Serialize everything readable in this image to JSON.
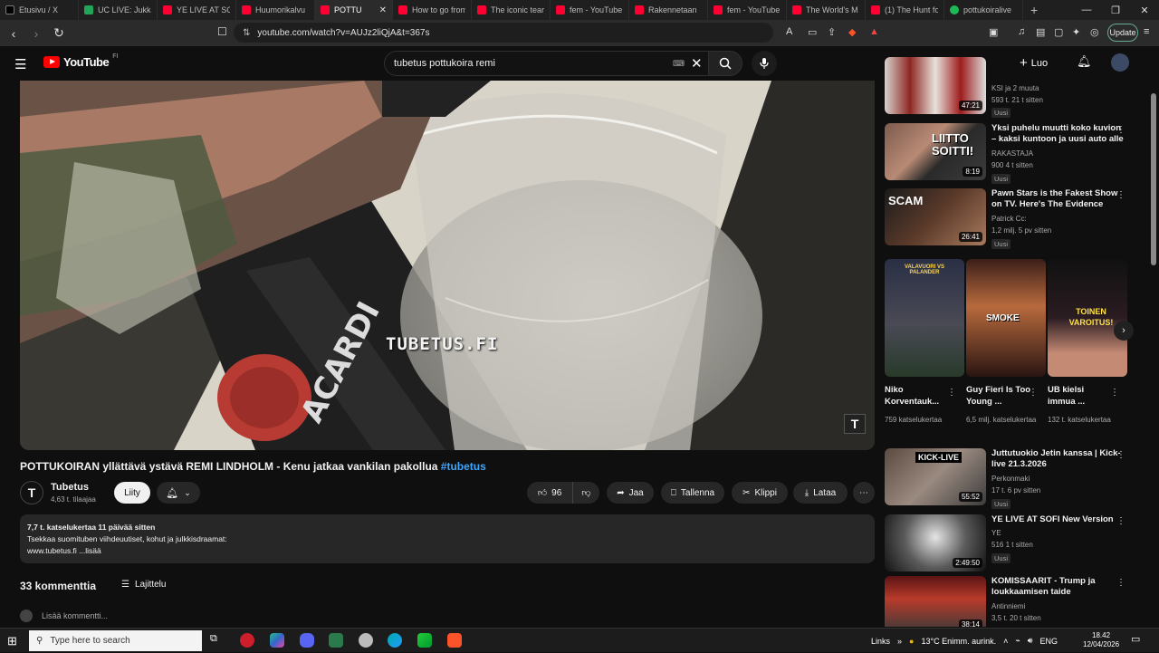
{
  "browser": {
    "tabs": [
      {
        "title": "Etusivu / X",
        "icon": "x"
      },
      {
        "title": "UC LIVE: Jukka",
        "icon": "sp"
      },
      {
        "title": "YE LIVE AT SOFI",
        "icon": "yt"
      },
      {
        "title": "Huumorikalvu",
        "icon": "yt"
      },
      {
        "title": "POTTU",
        "icon": "yt",
        "active": true
      },
      {
        "title": "How to go from",
        "icon": "yt"
      },
      {
        "title": "The iconic tear",
        "icon": "yt"
      },
      {
        "title": "fem - YouTube",
        "icon": "yt"
      },
      {
        "title": "Rakennetaan",
        "icon": "yt"
      },
      {
        "title": "fem - YouTube",
        "icon": "yt"
      },
      {
        "title": "The World's M",
        "icon": "yt"
      },
      {
        "title": "(1) The Hunt fo",
        "icon": "yt"
      },
      {
        "title": "pottukoiralive",
        "icon": "g"
      }
    ],
    "url": "youtube.com/watch?v=AUJz2liQjA&t=367s",
    "update_label": "Update"
  },
  "youtube": {
    "logo_text": "YouTube",
    "country": "FI",
    "search_value": "tubetus pottukoira remi",
    "create_label": "Luo"
  },
  "video": {
    "watermark": "TUBETUS.FI",
    "channel_bug": "T",
    "title": "POTTUKOIRAN yllättävä ystävä REMI LINDHOLM - Kenu jatkaa vankilan pakollua",
    "hashtag": "#tubetus",
    "channel_name": "Tubetus",
    "subscribers": "4,63 t. tilaajaa",
    "join_label": "Liity",
    "like_count": "96",
    "share_label": "Jaa",
    "save_label": "Tallenna",
    "clip_label": "Klippi",
    "download_label": "Lataa"
  },
  "description": {
    "meta": "7,7 t. katselukertaa  11 päivää sitten",
    "line1": "Tsekkaa suomituben viihdeuutiset, kohut ja julkkisdraamat:",
    "line2": "www.tubetus.fi ...lisää"
  },
  "comments": {
    "count": "33 kommenttia",
    "sort_label": "Lajittelu",
    "placeholder": "Lisää kommentti..."
  },
  "recommendations": [
    {
      "title": "",
      "channel": "KSI ja 2 muuta",
      "stats": "593 t.  21 t sitten",
      "badge": "Uusi",
      "duration": "47:21"
    },
    {
      "title": "Yksi puhelu muutti koko kuvion – kaksi kuntoon ja uusi auto alle",
      "channel": "RAKASTAJA",
      "stats": "900  4 t sitten",
      "badge": "Uusi",
      "duration": "8:19",
      "thumb_text": "LIITTO SOITTI!"
    },
    {
      "title": "Pawn Stars is the Fakest Show on TV. Here's The Evidence",
      "channel": "Patrick Cc:",
      "stats": "1,2 milj.  5 pv sitten",
      "badge": "Uusi",
      "duration": "26:41",
      "thumb_text": "SCAM"
    },
    {
      "title": "Juttutuokio Jetin kanssa | Kick-live 21.3.2026",
      "channel": "Perkonmaki",
      "stats": "17 t.  6 pv sitten",
      "badge": "Uusi",
      "duration": "55:52",
      "thumb_text": "KICK-LIVE"
    },
    {
      "title": "YE LIVE AT SOFI  New Version",
      "channel": "YE",
      "stats": "516  1 t sitten",
      "badge": "Uusi",
      "duration": "2:49:50"
    },
    {
      "title": "KOMISSAARIT - Trump ja loukkaamisen taide",
      "channel": "Antinniemi",
      "stats": "3,5 t.  20 t sitten",
      "badge": "",
      "duration": "38:14"
    }
  ],
  "shorts": [
    {
      "title": "Niko Korventauk...",
      "views": "759 katselukertaa",
      "thumb_text": "VALAVUORI VS PALANDER"
    },
    {
      "title": "Guy Fieri Is Too Young ...",
      "views": "6,5 milj. katselukertaa",
      "thumb_text": "SMOKE"
    },
    {
      "title": "UB kielsi immua ...",
      "views": "132 t. katselukertaa",
      "thumb_text": "TOINEN VAROITUS!"
    }
  ],
  "taskbar": {
    "search_placeholder": "Type here to search",
    "links_label": "Links",
    "weather": "13°C  Enimm. aurink.",
    "language": "ENG",
    "time": "18.42",
    "date": "12/04/2026"
  },
  "colors": {
    "accent_link": "#3ea6ff",
    "youtube_red": "#ff0000",
    "background": "#0f0f0f",
    "surface": "#272727"
  }
}
